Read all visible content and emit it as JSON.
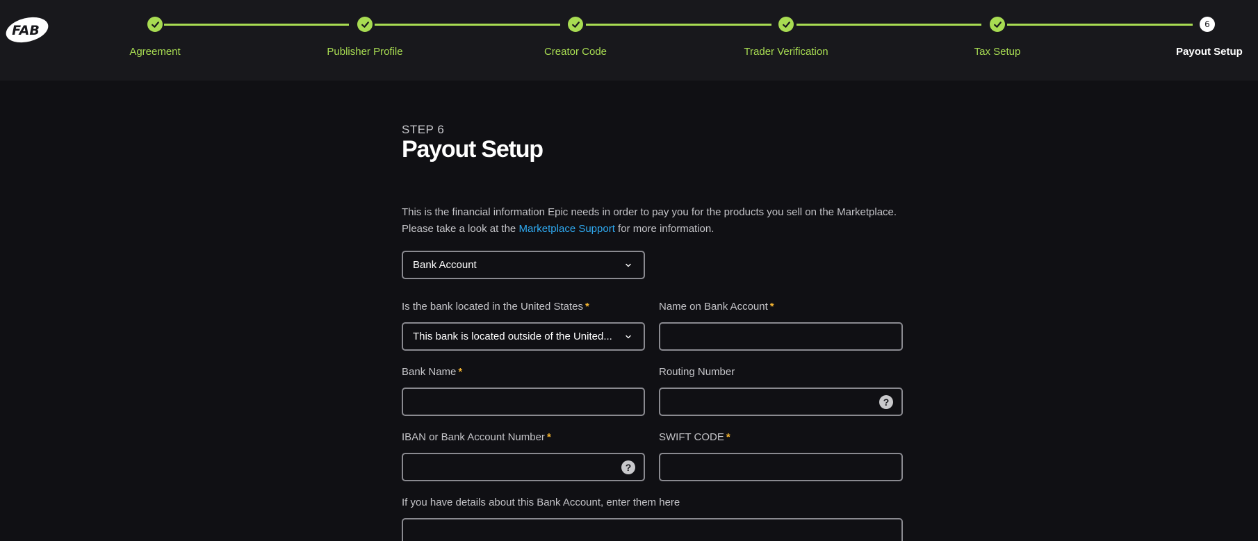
{
  "brand": {
    "logo_text": "FAB"
  },
  "stepper": {
    "steps": [
      {
        "label": "Agreement",
        "status": "complete"
      },
      {
        "label": "Publisher Profile",
        "status": "complete"
      },
      {
        "label": "Creator Code",
        "status": "complete"
      },
      {
        "label": "Trader Verification",
        "status": "complete"
      },
      {
        "label": "Tax Setup",
        "status": "complete"
      },
      {
        "label": "Payout Setup",
        "status": "current",
        "number": "6"
      }
    ]
  },
  "page": {
    "kicker": "STEP 6",
    "title": "Payout Setup",
    "intro_before": "This is the financial information Epic needs in order to pay you for the products you sell on the Marketplace. Please take a look at the ",
    "intro_link": "Marketplace Support",
    "intro_after": " for more information."
  },
  "form": {
    "payout_method": {
      "value": "Bank Account"
    },
    "bank_location": {
      "label": "Is the bank located in the United States",
      "required_mark": "*",
      "value": "This bank is located outside of the United..."
    },
    "name_on_account": {
      "label": "Name on Bank Account",
      "required_mark": "*",
      "value": ""
    },
    "bank_name": {
      "label": "Bank Name",
      "required_mark": "*",
      "value": ""
    },
    "routing_number": {
      "label": "Routing Number",
      "value": "",
      "help": "?"
    },
    "iban": {
      "label": "IBAN or Bank Account Number",
      "required_mark": "*",
      "value": "",
      "help": "?"
    },
    "swift": {
      "label": "SWIFT CODE",
      "required_mark": "*",
      "value": ""
    },
    "details": {
      "label": "If you have details about this Bank Account, enter them here",
      "value": ""
    }
  },
  "colors": {
    "accent": "#a8dc52",
    "link": "#2fa9f0",
    "required": "#f3b431",
    "background": "#101014",
    "header_bg": "#18181c"
  },
  "icons": [
    "fab-logo",
    "check-icon",
    "chevron-down-icon",
    "help-icon"
  ]
}
